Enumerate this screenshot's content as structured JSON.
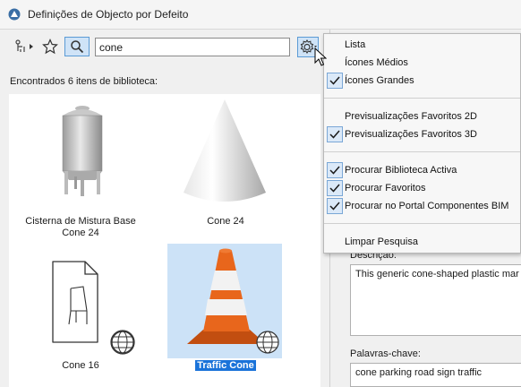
{
  "window": {
    "title": "Definições de Objecto por Defeito"
  },
  "toolbar": {
    "search_value": "cone"
  },
  "results": {
    "found_text": "Encontrados 6 itens de biblioteca:",
    "items": [
      {
        "label_line1": "Cisterna de Mistura Base",
        "label_line2": "Cone 24"
      },
      {
        "label_line1": "Cone 24"
      },
      {
        "label_line1": "Cone 16"
      },
      {
        "label_line1": "Traffic Cone"
      }
    ]
  },
  "menu": {
    "items": [
      {
        "label": "Lista",
        "checked": false
      },
      {
        "label": "Ícones Médios",
        "checked": false
      },
      {
        "label": "Ícones Grandes",
        "checked": true
      },
      {
        "label": "Previsualizações Favoritos 2D",
        "checked": false
      },
      {
        "label": "Previsualizações Favoritos 3D",
        "checked": true
      },
      {
        "label": "Procurar Biblioteca Activa",
        "checked": true
      },
      {
        "label": "Procurar Favoritos",
        "checked": true
      },
      {
        "label": "Procurar no Portal Componentes BIM",
        "checked": true
      },
      {
        "label": "Limpar Pesquisa",
        "checked": false
      }
    ]
  },
  "details": {
    "description_label": "Descrição:",
    "description_text": "This generic cone-shaped plastic mar",
    "keywords_label": "Palavras-chave:",
    "keywords_text": "cone parking road sign traffic"
  },
  "colors": {
    "accent": "#1a73d9",
    "selection": "#cce2f7",
    "cone_orange": "#e8661c"
  }
}
